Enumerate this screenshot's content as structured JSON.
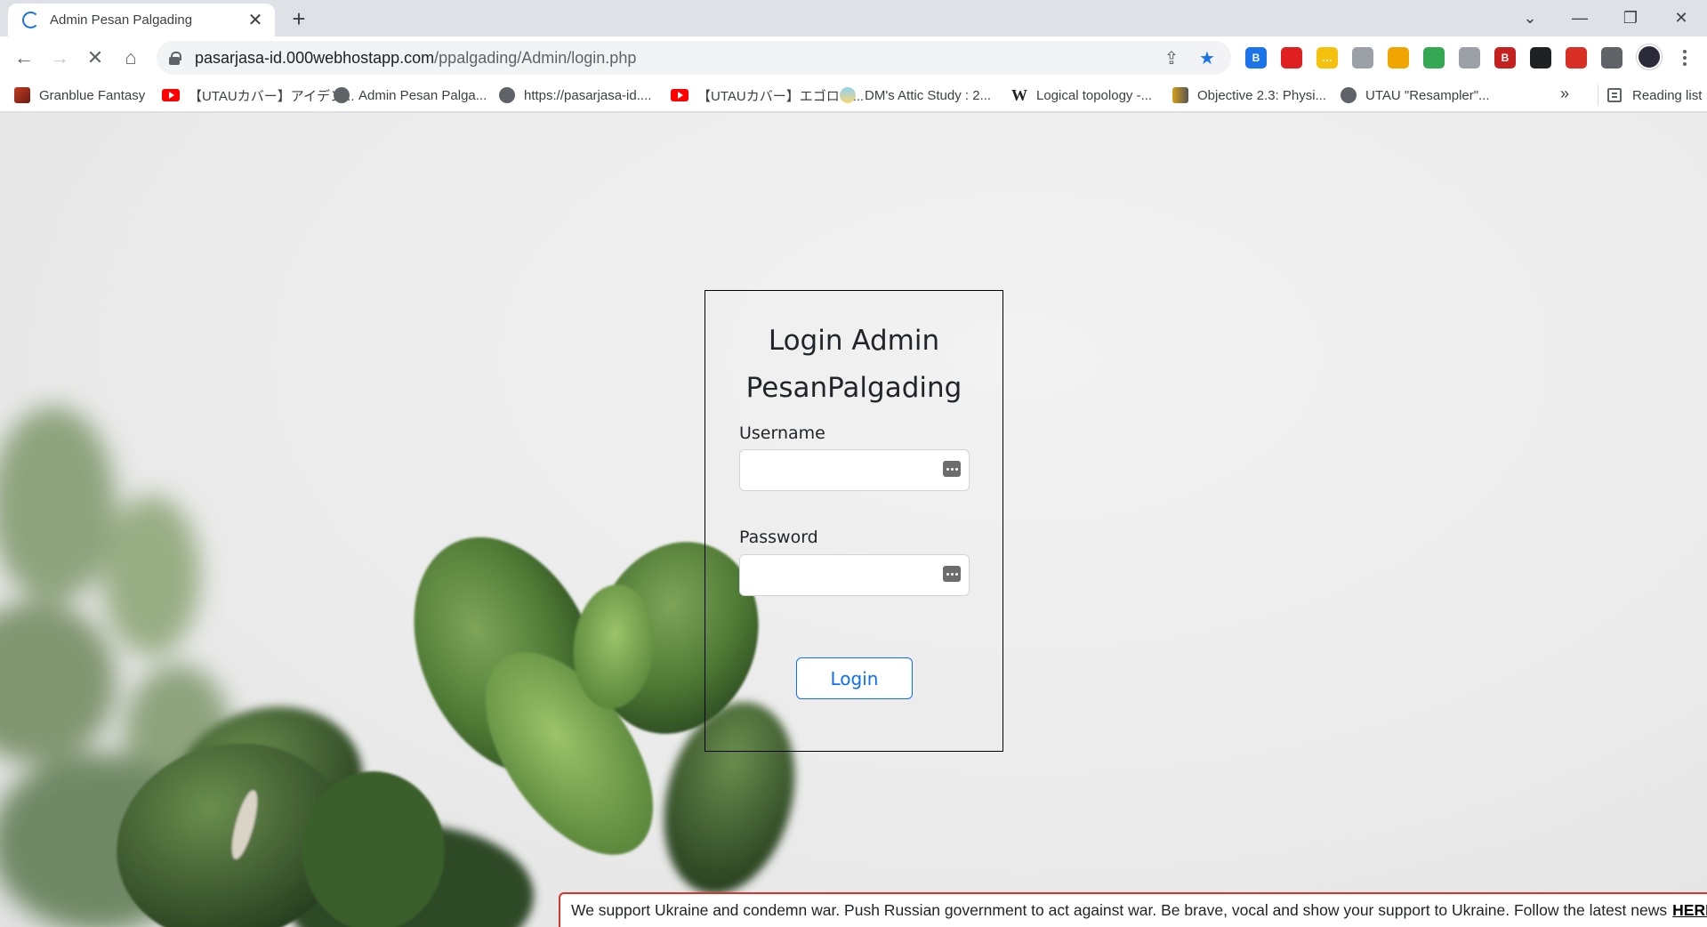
{
  "browser": {
    "tab": {
      "title": "Admin Pesan Palgading",
      "close_glyph": "✕"
    },
    "new_tab_glyph": "+",
    "window_controls": {
      "tab_search": "⌄",
      "minimize": "—",
      "restore": "❐",
      "close": "✕"
    },
    "nav": {
      "back": "←",
      "forward": "→",
      "stop": "✕",
      "home": "⌂"
    },
    "address": {
      "host": "pasarjasa-id.000webhostapp.com",
      "path": "/ppalgading/Admin/login.php"
    },
    "star_glyph": "★",
    "share_glyph": "⇪",
    "extensions": [
      {
        "icon": "b-extension-icon",
        "text": "B",
        "color": "#1a73e8"
      },
      {
        "icon": "ublock-icon",
        "text": "",
        "color": "#e02020"
      },
      {
        "icon": "notes-extension-icon",
        "text": "…",
        "color": "#f4c20d"
      },
      {
        "icon": "document-icon",
        "text": "",
        "color": "#9aa0a6"
      },
      {
        "icon": "bee-extension-icon",
        "text": "",
        "color": "#f0a500"
      },
      {
        "icon": "globe-earth-icon",
        "text": "",
        "color": "#34a853"
      },
      {
        "icon": "web-globe-icon",
        "text": "",
        "color": "#9aa0a6"
      },
      {
        "icon": "bitwarden-icon",
        "text": "B",
        "color": "#c5221f"
      },
      {
        "icon": "tampermonkey-icon",
        "text": "",
        "color": "#202124"
      },
      {
        "icon": "block-extension-icon",
        "text": "",
        "color": "#d93025"
      },
      {
        "icon": "puzzle-icon",
        "text": "",
        "color": "#5f6368"
      }
    ],
    "bookmarks": [
      {
        "label": "Granblue Fantasy",
        "icon": "granblue-icon"
      },
      {
        "label": "【UTAUカバー】アイデン...",
        "icon": "youtube-icon"
      },
      {
        "label": "Admin Pesan Palga...",
        "icon": "globe-icon"
      },
      {
        "label": "https://pasarjasa-id....",
        "icon": "globe-icon"
      },
      {
        "label": "【UTAUカバー】エゴロッ...",
        "icon": "youtube-icon"
      },
      {
        "label": "DM's Attic Study : 2...",
        "icon": "dm-attic-icon"
      },
      {
        "label": "Logical topology -...",
        "icon": "wikipedia-icon"
      },
      {
        "label": "Objective 2.3: Physi...",
        "icon": "objective-icon"
      },
      {
        "label": "UTAU \"Resampler\"...",
        "icon": "globe-icon"
      }
    ],
    "bookmarks_more": "»",
    "reading_list": "Reading list"
  },
  "login": {
    "title_line1": "Login Admin",
    "title_line2": "PesanPalgading",
    "username_label": "Username",
    "username_value": "",
    "password_label": "Password",
    "password_value": "",
    "button_label": "Login"
  },
  "banner": {
    "text": "We support Ukraine and condemn war. Push Russian government to act against war. Be brave, vocal and show your support to Ukraine. Follow the latest news",
    "link": "HERE"
  }
}
